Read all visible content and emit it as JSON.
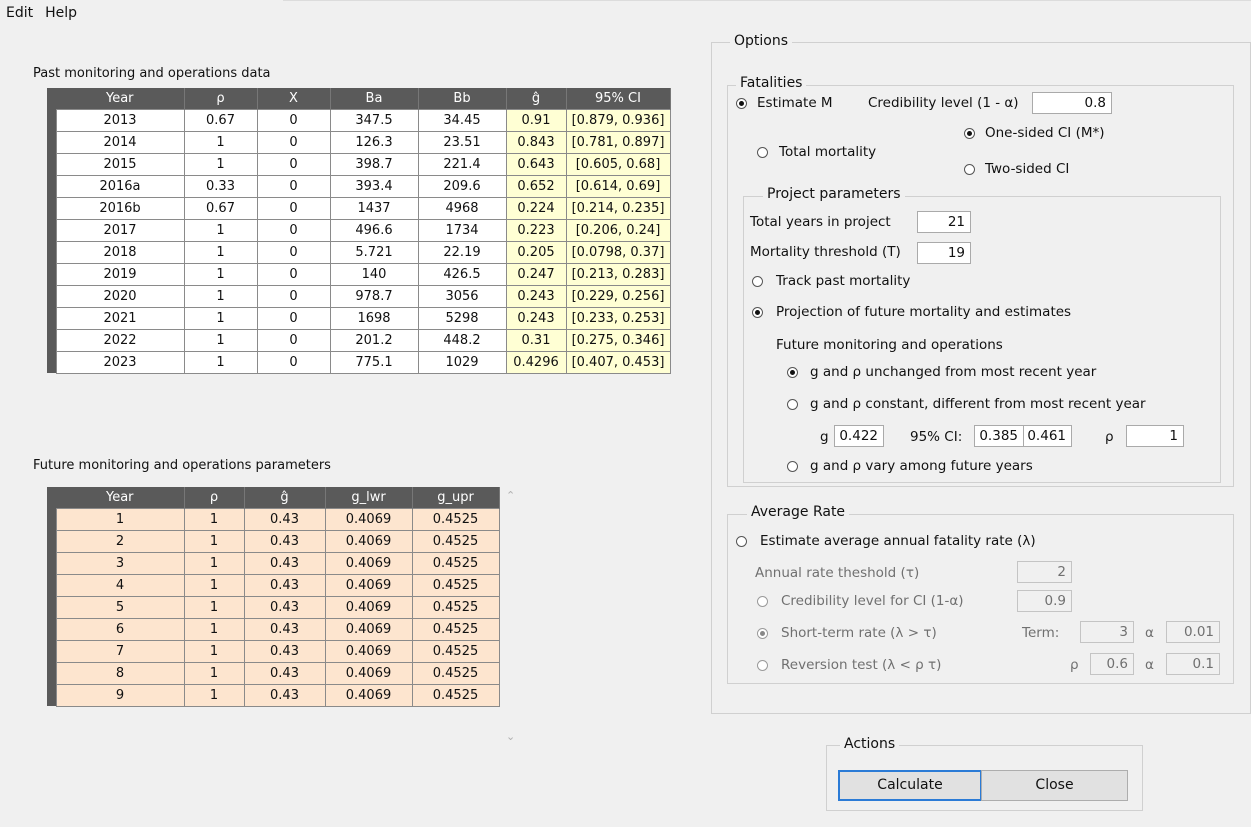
{
  "menu": {
    "edit": "Edit",
    "help": "Help"
  },
  "past": {
    "title": "Past monitoring and operations data",
    "columns": [
      "Year",
      "ρ",
      "X",
      "Ba",
      "Bb",
      "ĝ",
      "95% CI"
    ],
    "rows": [
      [
        "2013",
        "0.67",
        "0",
        "347.5",
        "34.45",
        "0.91",
        "[0.879, 0.936]"
      ],
      [
        "2014",
        "1",
        "0",
        "126.3",
        "23.51",
        "0.843",
        "[0.781, 0.897]"
      ],
      [
        "2015",
        "1",
        "0",
        "398.7",
        "221.4",
        "0.643",
        "[0.605, 0.68]"
      ],
      [
        "2016a",
        "0.33",
        "0",
        "393.4",
        "209.6",
        "0.652",
        "[0.614, 0.69]"
      ],
      [
        "2016b",
        "0.67",
        "0",
        "1437",
        "4968",
        "0.224",
        "[0.214, 0.235]"
      ],
      [
        "2017",
        "1",
        "0",
        "496.6",
        "1734",
        "0.223",
        "[0.206, 0.24]"
      ],
      [
        "2018",
        "1",
        "0",
        "5.721",
        "22.19",
        "0.205",
        "[0.0798, 0.37]"
      ],
      [
        "2019",
        "1",
        "0",
        "140",
        "426.5",
        "0.247",
        "[0.213, 0.283]"
      ],
      [
        "2020",
        "1",
        "0",
        "978.7",
        "3056",
        "0.243",
        "[0.229, 0.256]"
      ],
      [
        "2021",
        "1",
        "0",
        "1698",
        "5298",
        "0.243",
        "[0.233, 0.253]"
      ],
      [
        "2022",
        "1",
        "0",
        "201.2",
        "448.2",
        "0.31",
        "[0.275, 0.346]"
      ],
      [
        "2023",
        "1",
        "0",
        "775.1",
        "1029",
        "0.4296",
        "[0.407, 0.453]"
      ]
    ]
  },
  "future": {
    "title": "Future monitoring and operations parameters",
    "columns": [
      "Year",
      "ρ",
      "ĝ",
      "g_lwr",
      "g_upr"
    ],
    "rows": [
      [
        "1",
        "1",
        "0.43",
        "0.4069",
        "0.4525"
      ],
      [
        "2",
        "1",
        "0.43",
        "0.4069",
        "0.4525"
      ],
      [
        "3",
        "1",
        "0.43",
        "0.4069",
        "0.4525"
      ],
      [
        "4",
        "1",
        "0.43",
        "0.4069",
        "0.4525"
      ],
      [
        "5",
        "1",
        "0.43",
        "0.4069",
        "0.4525"
      ],
      [
        "6",
        "1",
        "0.43",
        "0.4069",
        "0.4525"
      ],
      [
        "7",
        "1",
        "0.43",
        "0.4069",
        "0.4525"
      ],
      [
        "8",
        "1",
        "0.43",
        "0.4069",
        "0.4525"
      ],
      [
        "9",
        "1",
        "0.43",
        "0.4069",
        "0.4525"
      ]
    ]
  },
  "options": {
    "title": "Options",
    "fatalities": {
      "title": "Fatalities",
      "estimate_m": "Estimate M",
      "credibility_label": "Credibility level (1 - α)",
      "credibility_value": "0.8",
      "total_mortality": "Total mortality",
      "one_sided": "One-sided CI (M*)",
      "two_sided": "Two-sided CI"
    },
    "project": {
      "title": "Project parameters",
      "total_years_label": "Total years in project",
      "total_years_value": "21",
      "threshold_label": "Mortality threshold (T)",
      "threshold_value": "19",
      "track_past": "Track past mortality",
      "projection": "Projection of future mortality and estimates",
      "future_label": "Future monitoring and operations",
      "unchanged": "g and ρ unchanged from most recent year",
      "constant": "g and ρ constant, different from most recent year",
      "g_label": "g",
      "g_value": "0.422",
      "ci_label": "95% CI:",
      "ci_low": "0.385",
      "ci_high": "0.461",
      "rho_label": "ρ",
      "rho_value": "1",
      "vary": "g and ρ vary among future years"
    },
    "avg_rate": {
      "title": "Average Rate",
      "estimate": "Estimate average annual fatality rate (λ)",
      "threshold_label": "Annual rate theshold (τ)",
      "threshold_value": "2",
      "cred_label": "Credibility level for CI (1-α)",
      "cred_value": "0.9",
      "short_term": "Short-term rate (λ > τ)",
      "term_label": "Term:",
      "term_value": "3",
      "alpha_label": "α",
      "alpha1_value": "0.01",
      "reversion": "Reversion test (λ < ρ τ)",
      "rho_label": "ρ",
      "rho_value": "0.6",
      "alpha2_value": "0.1"
    }
  },
  "actions": {
    "title": "Actions",
    "calculate": "Calculate",
    "close": "Close"
  }
}
